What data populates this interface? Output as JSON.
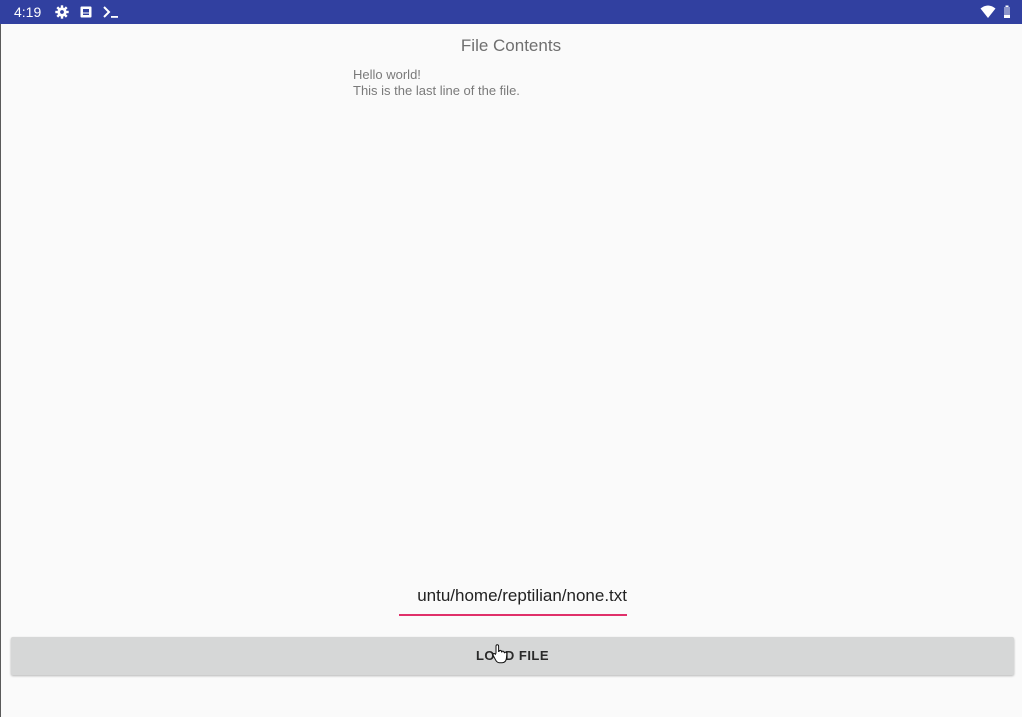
{
  "status_bar": {
    "time": "4:19",
    "color": "#3140a0",
    "icons": [
      "gear-icon",
      "notification-box-icon",
      "terminal-icon",
      "wifi-icon",
      "battery-icon"
    ]
  },
  "file_view": {
    "title": "File Contents",
    "lines": [
      "Hello world!",
      "This is the last line of the file."
    ]
  },
  "path_input": {
    "value": "untu/home/reptilian/none.txt",
    "underline_color": "#e0306a"
  },
  "load_button": {
    "label": "LOAD FILE"
  }
}
